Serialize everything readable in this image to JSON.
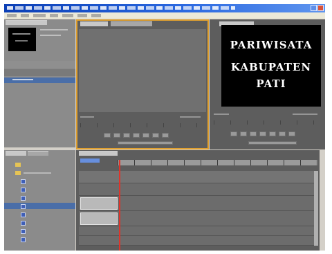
{
  "program_monitor": {
    "title_card": {
      "line1": "PARIWISATA",
      "line2": "KABUPATEN",
      "line3": "PATI"
    }
  },
  "colors": {
    "titlebar": "#0b3fb5",
    "panel_bg": "#8b8b8b",
    "active_panel_border": "#e0a030",
    "playhead": "#e0342a",
    "title_card_bg": "#000000",
    "title_card_text": "#ffffff"
  }
}
